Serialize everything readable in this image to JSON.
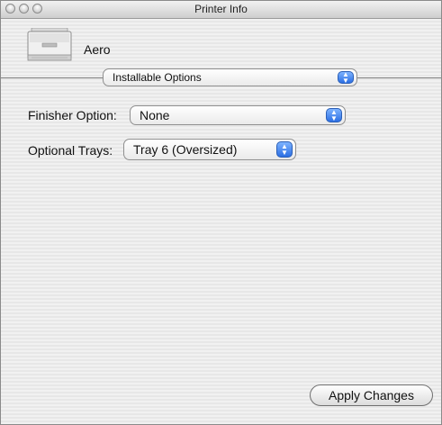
{
  "window": {
    "title": "Printer Info"
  },
  "printer": {
    "name": "Aero",
    "icon": "printer-icon"
  },
  "panel_selector": {
    "selected": "Installable Options"
  },
  "options": {
    "finisher": {
      "label": "Finisher Option:",
      "value": "None"
    },
    "trays": {
      "label": "Optional Trays:",
      "value": "Tray 6 (Oversized)"
    }
  },
  "buttons": {
    "apply": "Apply Changes"
  },
  "colors": {
    "popup_arrow": "#2c6fe3",
    "window_bg": "#ececec"
  }
}
